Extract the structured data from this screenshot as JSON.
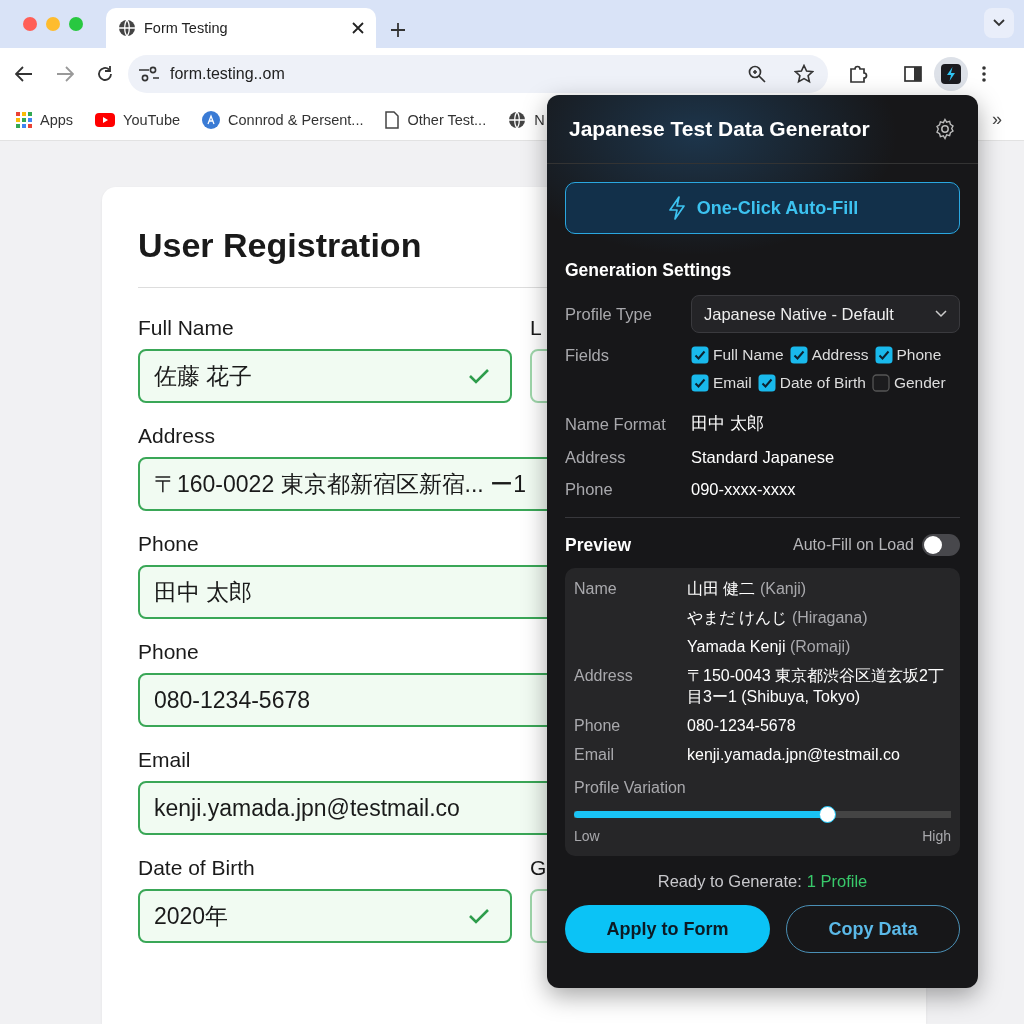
{
  "browser": {
    "tab_title": "Form Testing",
    "address": "form.testing..om",
    "bookmarks": [
      {
        "kind": "apps",
        "label": "Apps"
      },
      {
        "kind": "youtube",
        "label": "YouTube"
      },
      {
        "kind": "circle",
        "label": "Connrod & Persent..."
      },
      {
        "kind": "doc",
        "label": "Other Test..."
      },
      {
        "kind": "globe",
        "label": "N"
      }
    ],
    "more_bookmarks": "»"
  },
  "form": {
    "title": "User Registration",
    "rows": [
      {
        "fields": [
          {
            "label": "Full Name",
            "value": "佐藤 花子",
            "verified": true
          },
          {
            "label": "L"
          }
        ]
      },
      {
        "fields": [
          {
            "label": "Address",
            "value": "〒160-0022 東京都新宿区新宿... ー1"
          }
        ]
      },
      {
        "fields": [
          {
            "label": "Phone",
            "value": "田中 太郎"
          }
        ]
      },
      {
        "fields": [
          {
            "label": "Phone",
            "value": "080-1234-5678"
          }
        ]
      },
      {
        "fields": [
          {
            "label": "Email",
            "value": "kenji.yamada.jpn@testmail.co"
          }
        ]
      },
      {
        "fields": [
          {
            "label": "Date of Birth",
            "value": "2020年",
            "verified": true
          },
          {
            "label": "G"
          }
        ]
      }
    ]
  },
  "popup": {
    "title": "Japanese Test Data Generator",
    "autofill_button": "One-Click Auto-Fill",
    "settings_title": "Generation Settings",
    "profile_type": {
      "label": "Profile Type",
      "value": "Japanese Native - Default"
    },
    "fields_label": "Fields",
    "fields": [
      {
        "label": "Full Name",
        "checked": true
      },
      {
        "label": "Address",
        "checked": true
      },
      {
        "label": "Phone",
        "checked": true
      },
      {
        "label": "Email",
        "checked": true
      },
      {
        "label": "Date of Birth",
        "checked": true
      },
      {
        "label": "Gender",
        "checked": false
      }
    ],
    "settings": [
      {
        "label": "Name Format",
        "value": "田中 太郎"
      },
      {
        "label": "Address",
        "value": "Standard Japanese"
      },
      {
        "label": "Phone",
        "value": "090-xxxx-xxxx"
      }
    ],
    "preview_title": "Preview",
    "autofill_on_load": {
      "label": "Auto-Fill on Load",
      "on": false
    },
    "preview": [
      {
        "label": "Name",
        "lines": [
          {
            "value": "山田 健二",
            "note": "(Kanji)"
          },
          {
            "value": "やまだ けんじ",
            "note": "(Hiragana)"
          },
          {
            "value": "Yamada Kenji",
            "note": "(Romaji)"
          }
        ]
      },
      {
        "label": "Address",
        "lines": [
          {
            "value": "〒150-0043 東京都渋谷区道玄坂2丁目3ー1 (Shibuya, Tokyo)"
          }
        ]
      },
      {
        "label": "Phone",
        "lines": [
          {
            "value": "080-1234-5678"
          }
        ]
      },
      {
        "label": "Email",
        "lines": [
          {
            "value": "kenji.yamada.jpn@testmail.co"
          }
        ]
      }
    ],
    "variation": {
      "label": "Profile Variation",
      "level": 0.67,
      "low": "Low",
      "high": "High"
    },
    "status": {
      "text": "Ready to Generate:",
      "count": "1 Profile"
    },
    "buttons": [
      {
        "kind": "primary",
        "label": "Apply to Form"
      },
      {
        "kind": "outline",
        "label": "Copy Data"
      }
    ]
  }
}
